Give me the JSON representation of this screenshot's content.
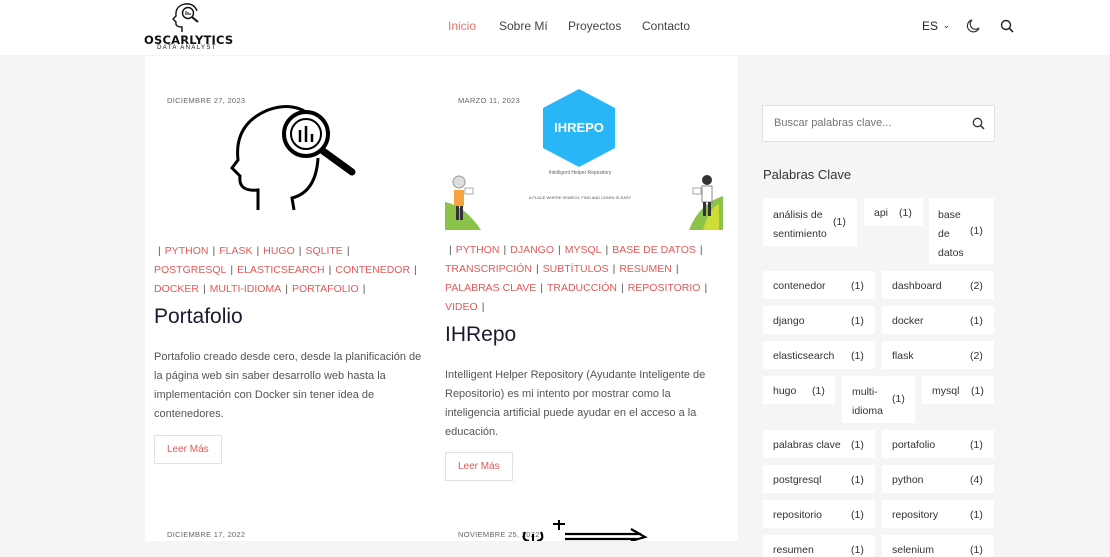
{
  "brand": {
    "title": "OSCARLYTICS",
    "subtitle": "DATA ANALYST"
  },
  "nav": [
    {
      "label": "Inicio",
      "active": true
    },
    {
      "label": "Sobre Mí",
      "active": false
    },
    {
      "label": "Proyectos",
      "active": false
    },
    {
      "label": "Contacto",
      "active": false
    }
  ],
  "header": {
    "lang": "ES",
    "theme_icon": "moon-icon",
    "search_icon": "search-icon"
  },
  "colors": {
    "accent": "#e05a5a",
    "ihrepo_blue": "#29b6f6",
    "green": "#8bc34a"
  },
  "posts": [
    {
      "date": "DICIEMBRE 27, 2023",
      "tags": [
        "PYTHON",
        "FLASK",
        "HUGO",
        "SQLITE",
        "POSTGRESQL",
        "ELASTICSEARCH",
        "CONTENEDOR",
        "DOCKER",
        "MULTI-IDIOMA",
        "PORTAFOLIO"
      ],
      "title": "Portafolio",
      "description": "Portafolio creado desde cero, desde la planificación de la página web sin saber desarrollo web hasta la implementación con Docker sin tener idea de contenedores.",
      "more": "Leer Más"
    },
    {
      "date": "MARZO 11, 2023",
      "image": {
        "logo": "IHREPO",
        "caption": "Intelligent Helper Repository",
        "tagline": "A PLACE WHERE SEARCH, FIND AND LEARN IS EASY"
      },
      "tags": [
        "PYTHON",
        "DJANGO",
        "MYSQL",
        "BASE DE DATOS",
        "TRANSCRIPCIÓN",
        "SUBTÍTULOS",
        "RESUMEN",
        "PALABRAS CLAVE",
        "TRADUCCIÓN",
        "REPOSITORIO",
        "VIDEO"
      ],
      "title": "IHRepo",
      "description": "Intelligent Helper Repository (Ayudante Inteligente de Repositorio) es mi intento por mostrar como la inteligencia artificial puede ayudar en el acceso a la educación.",
      "more": "Leer Más"
    },
    {
      "date": "DICIEMBRE 17, 2022"
    },
    {
      "date": "NOVIEMBRE 25, 2022"
    }
  ],
  "sidebar": {
    "search_placeholder": "Buscar palabras clave...",
    "keywords_title": "Palabras Clave",
    "keywords": [
      {
        "label": "análisis de sentimiento",
        "count": "(1)"
      },
      {
        "label": "api",
        "count": "(1)"
      },
      {
        "label": "base de datos",
        "count": "(1)"
      },
      {
        "label": "contenedor",
        "count": "(1)"
      },
      {
        "label": "dashboard",
        "count": "(2)"
      },
      {
        "label": "django",
        "count": "(1)"
      },
      {
        "label": "docker",
        "count": "(1)"
      },
      {
        "label": "elasticsearch",
        "count": "(1)"
      },
      {
        "label": "flask",
        "count": "(2)"
      },
      {
        "label": "hugo",
        "count": "(1)"
      },
      {
        "label": "multi-idioma",
        "count": "(1)"
      },
      {
        "label": "mysql",
        "count": "(1)"
      },
      {
        "label": "palabras clave",
        "count": "(1)"
      },
      {
        "label": "portafolio",
        "count": "(1)"
      },
      {
        "label": "postgresql",
        "count": "(1)"
      },
      {
        "label": "python",
        "count": "(4)"
      },
      {
        "label": "repositorio",
        "count": "(1)"
      },
      {
        "label": "repository",
        "count": "(1)"
      },
      {
        "label": "resumen",
        "count": "(1)"
      },
      {
        "label": "selenium",
        "count": "(1)"
      }
    ]
  }
}
